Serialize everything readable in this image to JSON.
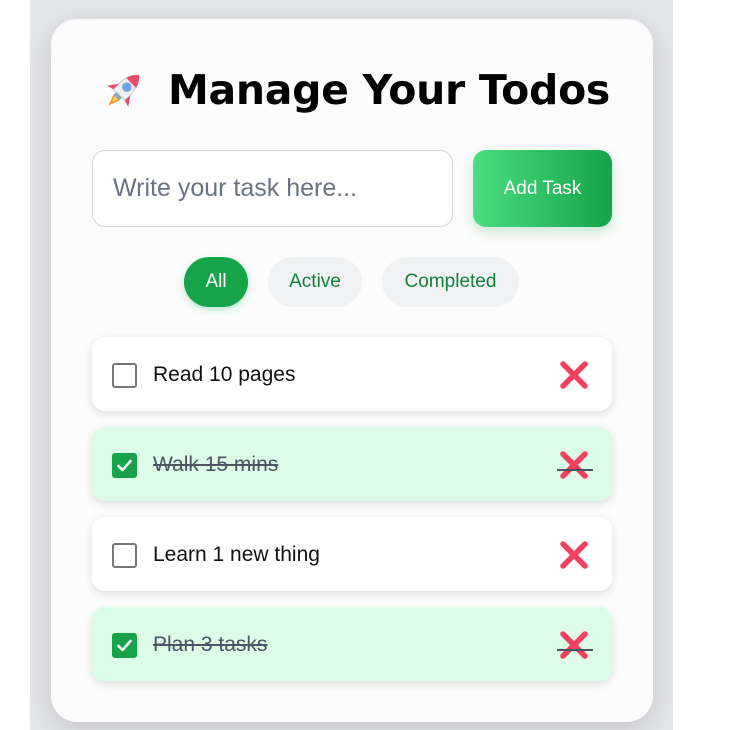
{
  "app": {
    "title": "Manage Your Todos",
    "title_icon": "rocket-icon"
  },
  "input": {
    "placeholder": "Write your task here...",
    "value": ""
  },
  "add_button": {
    "label": "Add Task"
  },
  "filters": [
    {
      "label": "All",
      "selected": true
    },
    {
      "label": "Active",
      "selected": false
    },
    {
      "label": "Completed",
      "selected": false
    }
  ],
  "todos": [
    {
      "text": "Read 10 pages",
      "completed": false
    },
    {
      "text": "Walk 15 mins",
      "completed": true
    },
    {
      "text": "Learn 1 new thing",
      "completed": false
    },
    {
      "text": "Plan 3 tasks",
      "completed": true
    }
  ],
  "colors": {
    "accent": "#16a34a",
    "accent_light": "#4ade80",
    "completed_bg": "#dcfce7",
    "delete": "#f43f5e",
    "card_bg": "#fbfcfb",
    "backdrop": "#e4e5e9"
  },
  "icons": {
    "delete": "cross-mark-icon",
    "check": "checkmark-icon"
  }
}
